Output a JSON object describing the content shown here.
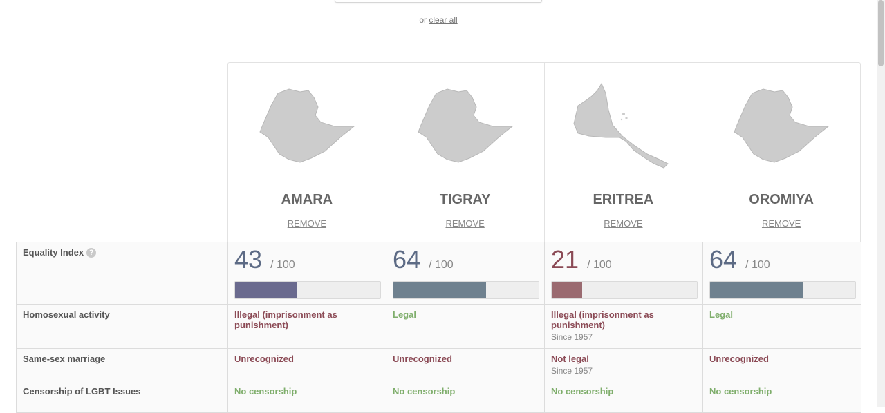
{
  "top": {
    "prefix": "or",
    "clear_all": "clear all"
  },
  "columns": [
    {
      "name": "AMARA",
      "remove": "REMOVE",
      "score": "43",
      "score_value": 43,
      "out_of": "/ 100",
      "bar_color": "#6a6a8e"
    },
    {
      "name": "TIGRAY",
      "remove": "REMOVE",
      "score": "64",
      "score_value": 64,
      "out_of": "/ 100",
      "bar_color": "#6f818f"
    },
    {
      "name": "ERITREA",
      "remove": "REMOVE",
      "score": "21",
      "score_value": 21,
      "out_of": "/ 100",
      "bar_color": "#9a6a70"
    },
    {
      "name": "OROMIYA",
      "remove": "REMOVE",
      "score": "64",
      "score_value": 64,
      "out_of": "/ 100",
      "bar_color": "#6f818f"
    }
  ],
  "colors": {
    "score_blue": "#5d6b85",
    "score_red": "#8b4a55",
    "negative": "#8b4a55",
    "positive": "#7fae6c"
  },
  "rows": {
    "equality": {
      "label": "Equality Index",
      "icon": "question-icon",
      "icon_glyph": "?"
    },
    "homosexual": {
      "label": "Homosexual activity",
      "values": [
        {
          "text": "Illegal (imprisonment as punishment)",
          "since": ""
        },
        {
          "text": "Legal",
          "since": ""
        },
        {
          "text": "Illegal (imprisonment as punishment)",
          "since": "Since 1957"
        },
        {
          "text": "Legal",
          "since": ""
        }
      ]
    },
    "marriage": {
      "label": "Same-sex marriage",
      "values": [
        {
          "text": "Unrecognized",
          "since": ""
        },
        {
          "text": "Unrecognized",
          "since": ""
        },
        {
          "text": "Not legal",
          "since": "Since 1957"
        },
        {
          "text": "Unrecognized",
          "since": ""
        }
      ]
    },
    "censorship": {
      "label": "Censorship of LGBT Issues",
      "values": [
        {
          "text": "No censorship",
          "since": ""
        },
        {
          "text": "No censorship",
          "since": ""
        },
        {
          "text": "No censorship",
          "since": ""
        },
        {
          "text": "No censorship",
          "since": ""
        }
      ]
    }
  }
}
